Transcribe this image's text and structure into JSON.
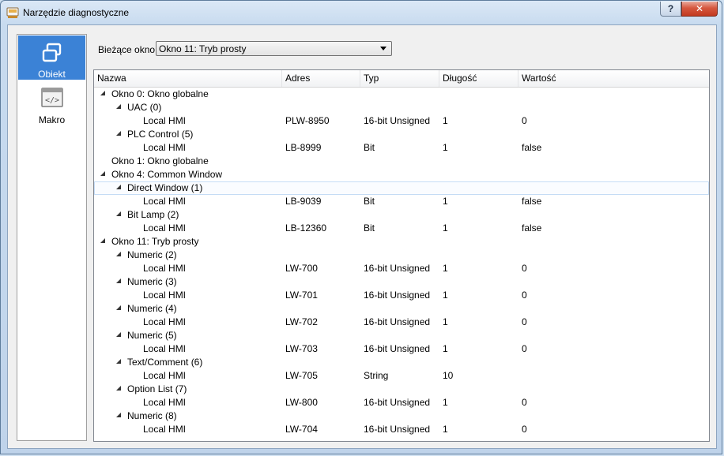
{
  "window": {
    "title": "Narzędzie diagnostyczne",
    "help_label": "?",
    "close_label": "✕"
  },
  "sidebar": {
    "items": [
      {
        "label": "Obiekt",
        "icon": "object-icon",
        "active": true
      },
      {
        "label": "Makro",
        "icon": "macro-icon",
        "active": false
      }
    ]
  },
  "current_window": {
    "label": "Bieżące okno:",
    "value": "Okno 11: Tryb prosty"
  },
  "tree": {
    "columns": [
      "Nazwa",
      "Adres",
      "Typ",
      "Długość",
      "Wartość"
    ],
    "rows": [
      {
        "level": 0,
        "expandable": true,
        "name": "Okno 0: Okno globalne",
        "address": "",
        "type": "",
        "length": "",
        "value": ""
      },
      {
        "level": 1,
        "expandable": true,
        "name": "UAC (0)",
        "address": "",
        "type": "",
        "length": "",
        "value": ""
      },
      {
        "level": 2,
        "expandable": false,
        "name": "Local HMI",
        "address": "PLW-8950",
        "type": "16-bit Unsigned",
        "length": "1",
        "value": "0"
      },
      {
        "level": 1,
        "expandable": true,
        "name": "PLC Control (5)",
        "address": "",
        "type": "",
        "length": "",
        "value": ""
      },
      {
        "level": 2,
        "expandable": false,
        "name": "Local HMI",
        "address": "LB-8999",
        "type": "Bit",
        "length": "1",
        "value": "false"
      },
      {
        "level": 0,
        "expandable": false,
        "name": "Okno 1: Okno globalne",
        "address": "",
        "type": "",
        "length": "",
        "value": ""
      },
      {
        "level": 0,
        "expandable": true,
        "name": "Okno 4: Common Window",
        "address": "",
        "type": "",
        "length": "",
        "value": ""
      },
      {
        "level": 1,
        "expandable": true,
        "name": "Direct Window (1)",
        "address": "",
        "type": "",
        "length": "",
        "value": "",
        "selected": true
      },
      {
        "level": 2,
        "expandable": false,
        "name": "Local HMI",
        "address": "LB-9039",
        "type": "Bit",
        "length": "1",
        "value": "false"
      },
      {
        "level": 1,
        "expandable": true,
        "name": "Bit Lamp (2)",
        "address": "",
        "type": "",
        "length": "",
        "value": ""
      },
      {
        "level": 2,
        "expandable": false,
        "name": "Local HMI",
        "address": "LB-12360",
        "type": "Bit",
        "length": "1",
        "value": "false"
      },
      {
        "level": 0,
        "expandable": true,
        "name": "Okno 11: Tryb prosty",
        "address": "",
        "type": "",
        "length": "",
        "value": ""
      },
      {
        "level": 1,
        "expandable": true,
        "name": "Numeric (2)",
        "address": "",
        "type": "",
        "length": "",
        "value": ""
      },
      {
        "level": 2,
        "expandable": false,
        "name": "Local HMI",
        "address": "LW-700",
        "type": "16-bit Unsigned",
        "length": "1",
        "value": "0"
      },
      {
        "level": 1,
        "expandable": true,
        "name": "Numeric (3)",
        "address": "",
        "type": "",
        "length": "",
        "value": ""
      },
      {
        "level": 2,
        "expandable": false,
        "name": "Local HMI",
        "address": "LW-701",
        "type": "16-bit Unsigned",
        "length": "1",
        "value": "0"
      },
      {
        "level": 1,
        "expandable": true,
        "name": "Numeric (4)",
        "address": "",
        "type": "",
        "length": "",
        "value": ""
      },
      {
        "level": 2,
        "expandable": false,
        "name": "Local HMI",
        "address": "LW-702",
        "type": "16-bit Unsigned",
        "length": "1",
        "value": "0"
      },
      {
        "level": 1,
        "expandable": true,
        "name": "Numeric (5)",
        "address": "",
        "type": "",
        "length": "",
        "value": ""
      },
      {
        "level": 2,
        "expandable": false,
        "name": "Local HMI",
        "address": "LW-703",
        "type": "16-bit Unsigned",
        "length": "1",
        "value": "0"
      },
      {
        "level": 1,
        "expandable": true,
        "name": "Text/Comment (6)",
        "address": "",
        "type": "",
        "length": "",
        "value": ""
      },
      {
        "level": 2,
        "expandable": false,
        "name": "Local HMI",
        "address": "LW-705",
        "type": "String",
        "length": "10",
        "value": ""
      },
      {
        "level": 1,
        "expandable": true,
        "name": "Option List (7)",
        "address": "",
        "type": "",
        "length": "",
        "value": ""
      },
      {
        "level": 2,
        "expandable": false,
        "name": "Local HMI",
        "address": "LW-800",
        "type": "16-bit Unsigned",
        "length": "1",
        "value": "0"
      },
      {
        "level": 1,
        "expandable": true,
        "name": "Numeric (8)",
        "address": "",
        "type": "",
        "length": "",
        "value": ""
      },
      {
        "level": 2,
        "expandable": false,
        "name": "Local HMI",
        "address": "LW-704",
        "type": "16-bit Unsigned",
        "length": "1",
        "value": "0"
      }
    ]
  },
  "colors": {
    "sidebar_active": "#3b82d6",
    "selection_outline": "#c5dcf5"
  }
}
